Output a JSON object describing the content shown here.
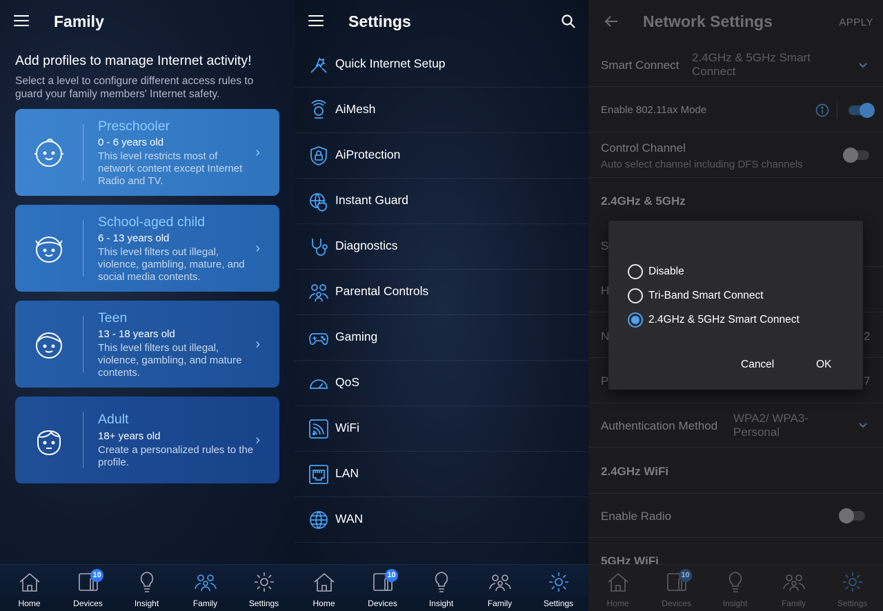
{
  "family": {
    "title": "Family",
    "heading": "Add profiles to manage Internet activity!",
    "subheading": "Select a level to configure different access rules to guard your family members' Internet safety.",
    "profiles": [
      {
        "name": "Preschooler",
        "age": "0 - 6 years old",
        "desc": "This level restricts most of network content except Internet Radio and TV.",
        "color": "#3b7fc9"
      },
      {
        "name": "School-aged child",
        "age": "6 - 13 years old",
        "desc": "This level filters out illegal, violence, gambling, mature, and social media contents.",
        "color": "#2d6bb7"
      },
      {
        "name": "Teen",
        "age": "13 - 18 years old",
        "desc": "This level filters out illegal, violence, gambling, and mature contents.",
        "color": "#2459a3"
      },
      {
        "name": "Adult",
        "age": "18+ years old",
        "desc": "Create a personalized rules to the profile.",
        "color": "#1d4b90"
      }
    ]
  },
  "settings": {
    "title": "Settings",
    "items": [
      {
        "label": "Quick Internet Setup",
        "icon": "quick-setup-icon"
      },
      {
        "label": "AiMesh",
        "icon": "aimesh-icon"
      },
      {
        "label": "AiProtection",
        "icon": "shield-lock-icon"
      },
      {
        "label": "Instant Guard",
        "icon": "instant-guard-icon"
      },
      {
        "label": "Diagnostics",
        "icon": "stethoscope-icon"
      },
      {
        "label": "Parental Controls",
        "icon": "parental-controls-icon"
      },
      {
        "label": "Gaming",
        "icon": "gamepad-icon"
      },
      {
        "label": "QoS",
        "icon": "speedometer-icon"
      },
      {
        "label": "WiFi",
        "icon": "wifi-icon"
      },
      {
        "label": "LAN",
        "icon": "lan-port-icon"
      },
      {
        "label": "WAN",
        "icon": "globe-icon"
      }
    ]
  },
  "network": {
    "title": "Network Settings",
    "apply": "APPLY",
    "smart_connect_label": "Smart Connect",
    "smart_connect_value": "2.4GHz & 5GHz Smart Connect",
    "ax_mode_label": "Enable 802.11ax Mode",
    "control_channel_label": "Control Channel",
    "control_channel_sub": "Auto select channel including DFS channels",
    "section_band": "2.4GHz & 5GHz",
    "frag_s": "S",
    "frag_h": "H",
    "frag_n": "N",
    "frag_n_right": "2",
    "frag_p": "P",
    "frag_p_right": "7",
    "auth_label": "Authentication Method",
    "auth_value": "WPA2/ WPA3-Personal",
    "section_24": "2.4GHz WiFi",
    "radio_label": "Enable Radio",
    "section_5": "5GHz WiFi",
    "dialog": {
      "options": [
        "Disable",
        "Tri-Band Smart Connect",
        "2.4GHz & 5GHz Smart Connect"
      ],
      "selected_index": 2,
      "cancel": "Cancel",
      "ok": "OK"
    }
  },
  "nav": {
    "items": [
      "Home",
      "Devices",
      "Insight",
      "Family",
      "Settings"
    ],
    "devices_badge": "10"
  }
}
